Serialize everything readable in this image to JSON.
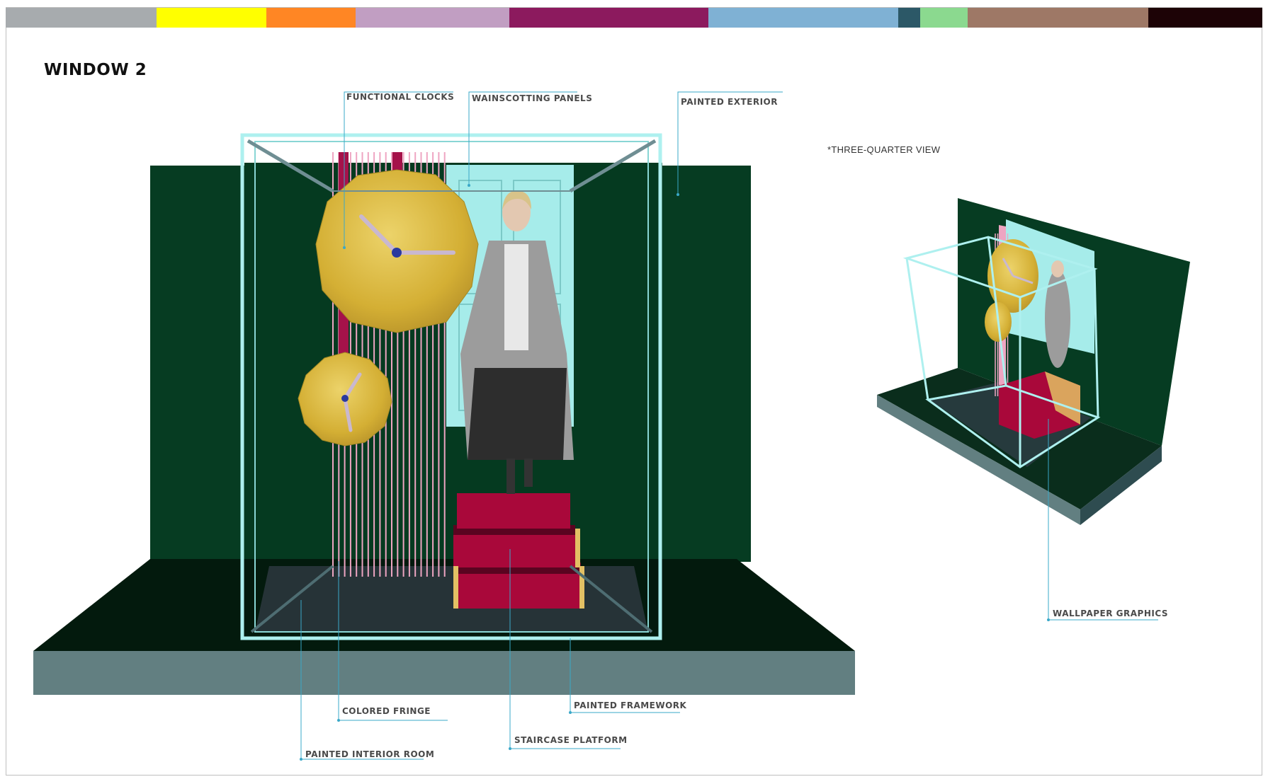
{
  "page": {
    "title": "WINDOW 2",
    "note": "*THREE-QUARTER VIEW"
  },
  "palette": [
    "#a7abae",
    "#ffff00",
    "#ff8624",
    "#c19ec2",
    "#8c1a5e",
    "#7fb1d4",
    "#2c5867",
    "#8bd98f",
    "#9e7866",
    "#1d0306"
  ],
  "labels": {
    "functional_clocks": "FUNCTIONAL CLOCKS",
    "wainscotting_panels": "WAINSCOTTING PANELS",
    "painted_exterior": "PAINTED EXTERIOR",
    "wallpaper_graphics": "WALLPAPER GRAPHICS",
    "colored_fringe": "COLORED FRINGE",
    "painted_framework": "PAINTED FRAMEWORK",
    "staircase_platform": "STAIRCASE PLATFORM",
    "painted_interior_room": "PAINTED INTERIOR ROOM"
  },
  "colors": {
    "wall_green": "#063c22",
    "floor_dark": "#041a0e",
    "stage_front": "#627f81",
    "frame": "#aef0ef",
    "panel_blue": "#a6ecea",
    "clock_gold": "#d9b83a",
    "fringe_pink": "#eea5c2",
    "fringe_bar": "#a5124a",
    "stair_red": "#a9083a",
    "leader_line": "#3aa8c8"
  }
}
